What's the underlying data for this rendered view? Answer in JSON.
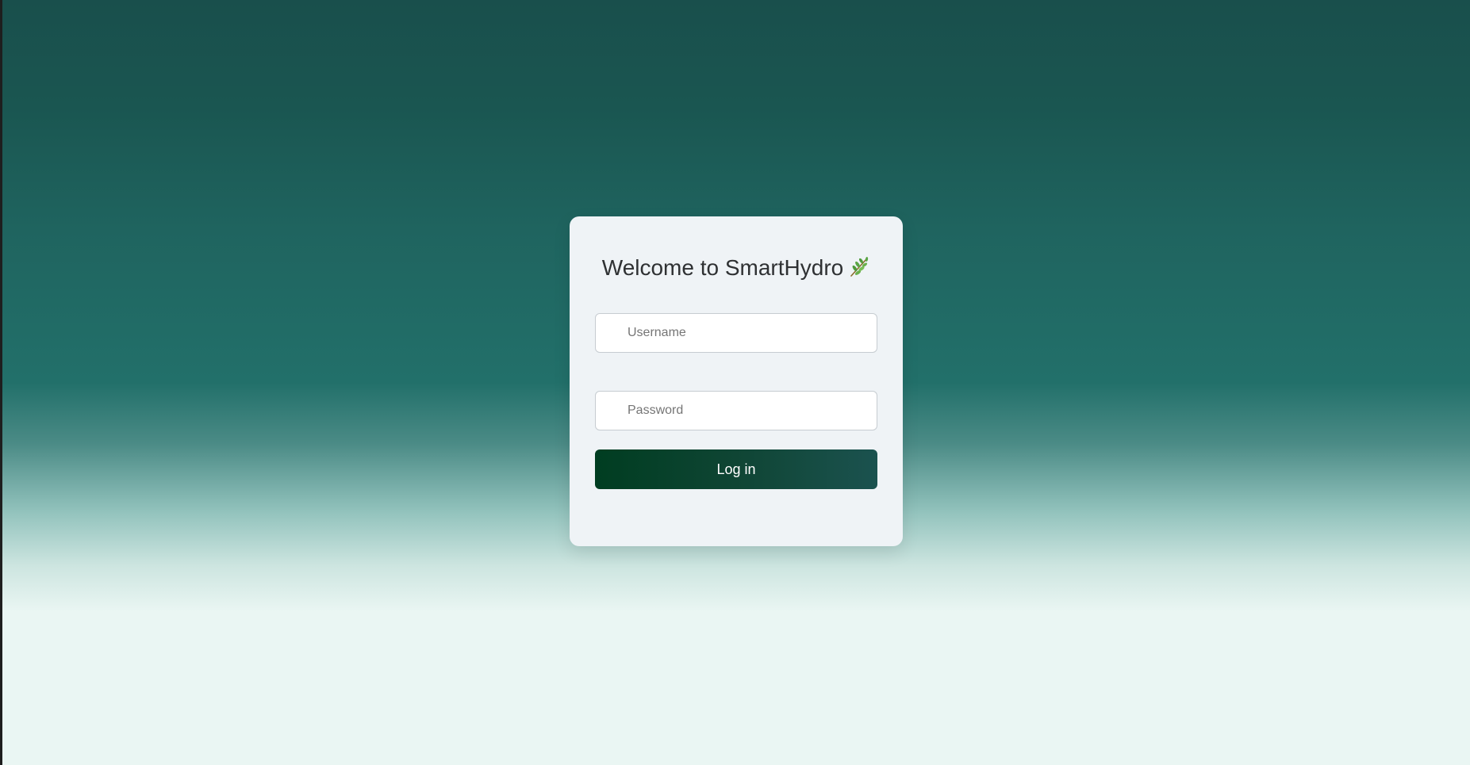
{
  "login": {
    "title": "Welcome to SmartHydro",
    "title_icon": "leaf-icon",
    "username_placeholder": "Username",
    "password_placeholder": "Password",
    "submit_label": "Log in"
  },
  "colors": {
    "background_top": "#194f4c",
    "background_mid": "#22706a",
    "background_bottom": "#eaf6f3",
    "card_background": "#eff3f6",
    "button_gradient_start": "#003d21",
    "button_gradient_end": "#1b524f",
    "button_text": "#ffffff",
    "title_text": "#2f3133"
  }
}
